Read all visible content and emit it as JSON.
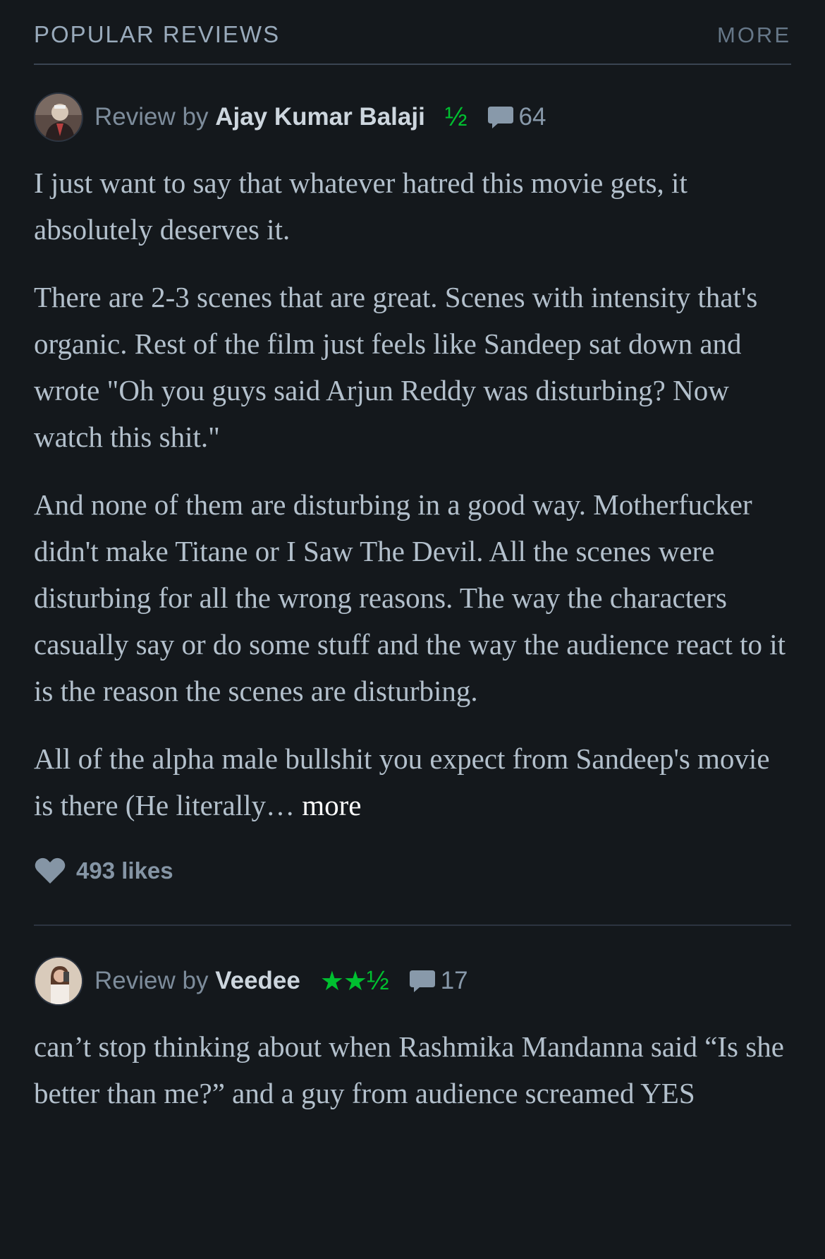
{
  "section": {
    "title": "POPULAR REVIEWS",
    "more_label": "MORE"
  },
  "reviews": [
    {
      "by_label": "Review by",
      "author": "Ajay Kumar Balaji",
      "rating_stars": "",
      "rating_half": "½",
      "comments": "64",
      "paragraphs": [
        "I just want to say that whatever hatred this movie gets, it absolutely deserves it.",
        "There are 2-3 scenes that are great. Scenes with intensity that's organic. Rest of the film just feels like Sandeep sat down and wrote \"Oh you guys said Arjun Reddy was disturbing? Now watch this shit.\"",
        "And none of them are disturbing in a good way. Motherfucker didn't make Titane or I Saw The Devil. All the scenes were disturbing for all the wrong reasons. The way the characters casually say or do some stuff and the way the audience react to it is the reason the scenes are disturbing.",
        "All of the alpha male bullshit you expect from Sandeep's movie is there (He literally…"
      ],
      "more_label": "more",
      "likes": "493 likes",
      "colors": {
        "rating": "#00c030"
      }
    },
    {
      "by_label": "Review by",
      "author": "Veedee",
      "rating_stars": "★★",
      "rating_half": "½",
      "comments": "17",
      "paragraphs": [
        "can’t stop thinking about when Rashmika Mandanna said “Is she better than me?” and a guy from audience screamed YES"
      ]
    }
  ],
  "icons": {
    "comment": "speech-bubble-icon",
    "like": "heart-icon"
  }
}
